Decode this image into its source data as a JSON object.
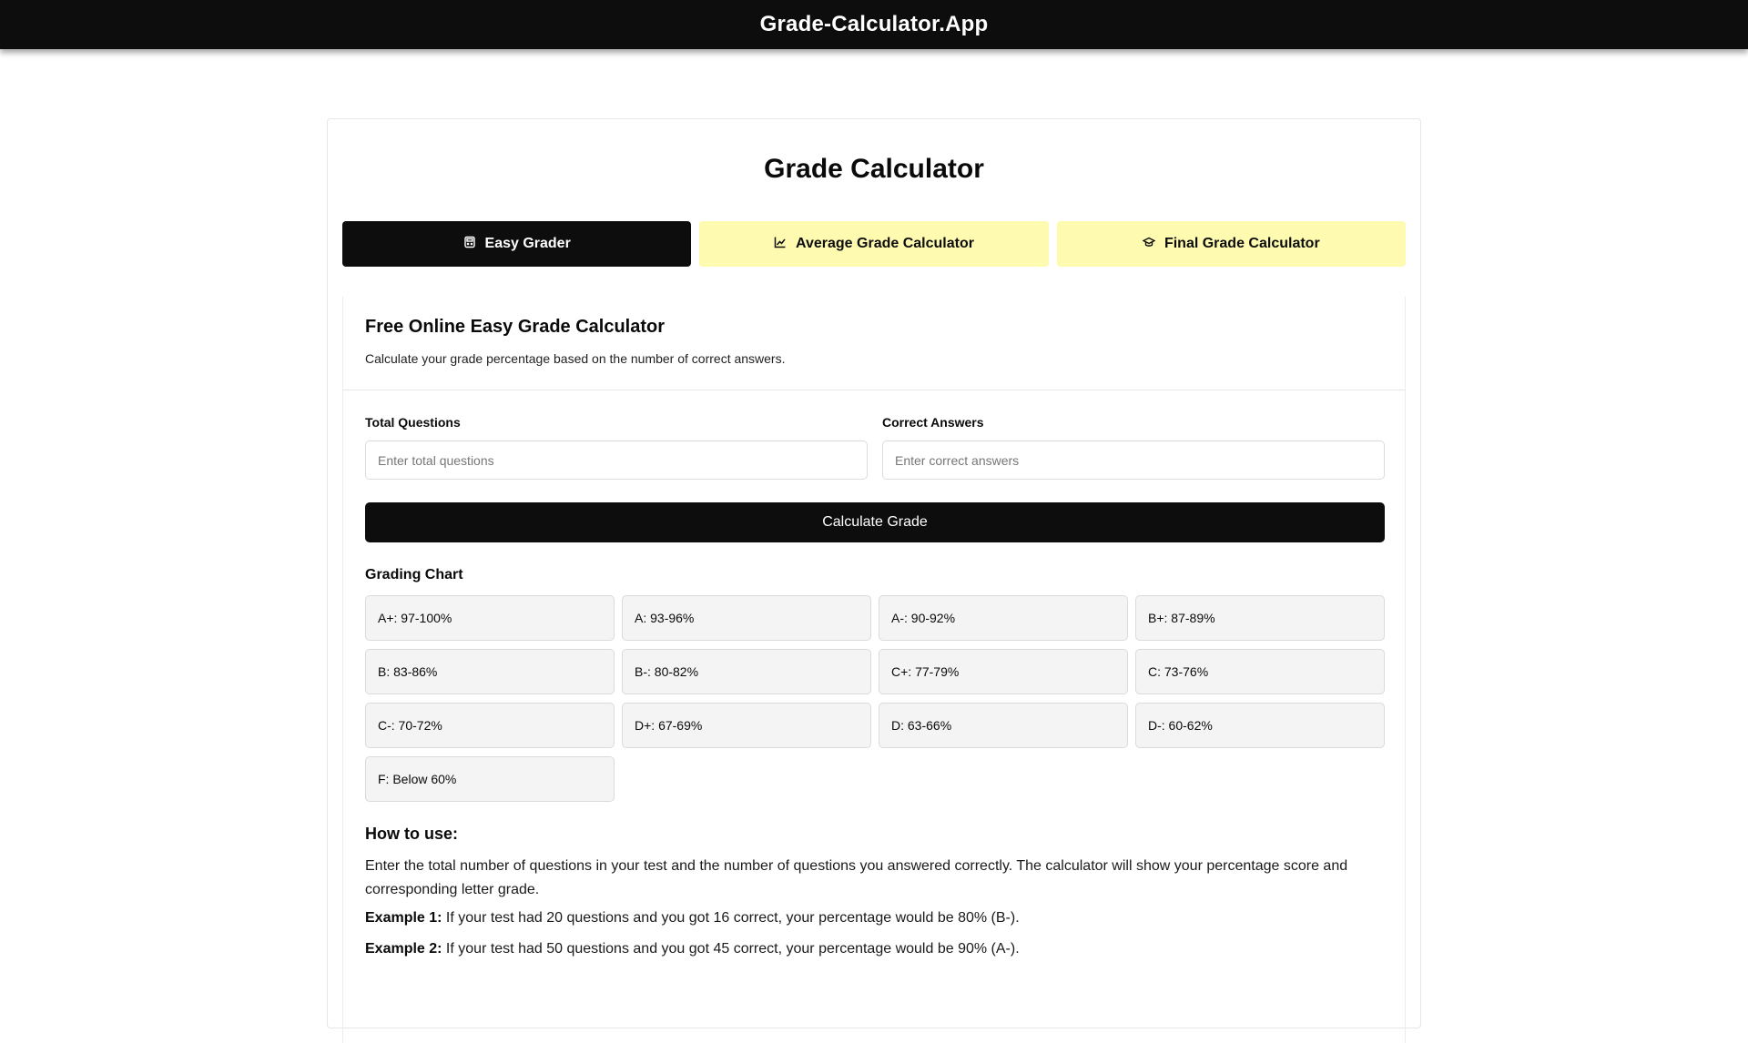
{
  "header": {
    "brand": "Grade-Calculator.App"
  },
  "page": {
    "title": "Grade Calculator"
  },
  "tabs": [
    {
      "label": "Easy Grader",
      "icon": "calculator-icon",
      "active": true
    },
    {
      "label": "Average Grade Calculator",
      "icon": "chart-line-icon",
      "active": false
    },
    {
      "label": "Final Grade Calculator",
      "icon": "graduation-cap-icon",
      "active": false
    }
  ],
  "calculator": {
    "title": "Free Online Easy Grade Calculator",
    "subtitle": "Calculate your grade percentage based on the number of correct answers.",
    "total_label": "Total Questions",
    "total_placeholder": "Enter total questions",
    "correct_label": "Correct Answers",
    "correct_placeholder": "Enter correct answers",
    "button_label": "Calculate Grade"
  },
  "grading_chart": {
    "title": "Grading Chart",
    "grades": [
      "A+: 97-100%",
      "A: 93-96%",
      "A-: 90-92%",
      "B+: 87-89%",
      "B: 83-86%",
      "B-: 80-82%",
      "C+: 77-79%",
      "C: 73-76%",
      "C-: 70-72%",
      "D+: 67-69%",
      "D: 63-66%",
      "D-: 60-62%",
      "F: Below 60%"
    ]
  },
  "howto": {
    "title": "How to use:",
    "text": "Enter the total number of questions in your test and the number of questions you answered correctly. The calculator will show your percentage score and corresponding letter grade.",
    "example1_label": "Example 1:",
    "example1_text": " If your test had 20 questions and you got 16 correct, your percentage would be 80% (B-).",
    "example2_label": "Example 2:",
    "example2_text": " If your test had 50 questions and you got 45 correct, your percentage would be 90% (A-)."
  },
  "colors": {
    "dark": "#0d0d0d",
    "tab_inactive": "#fefbb0",
    "cell_bg": "#f4f4f4"
  }
}
